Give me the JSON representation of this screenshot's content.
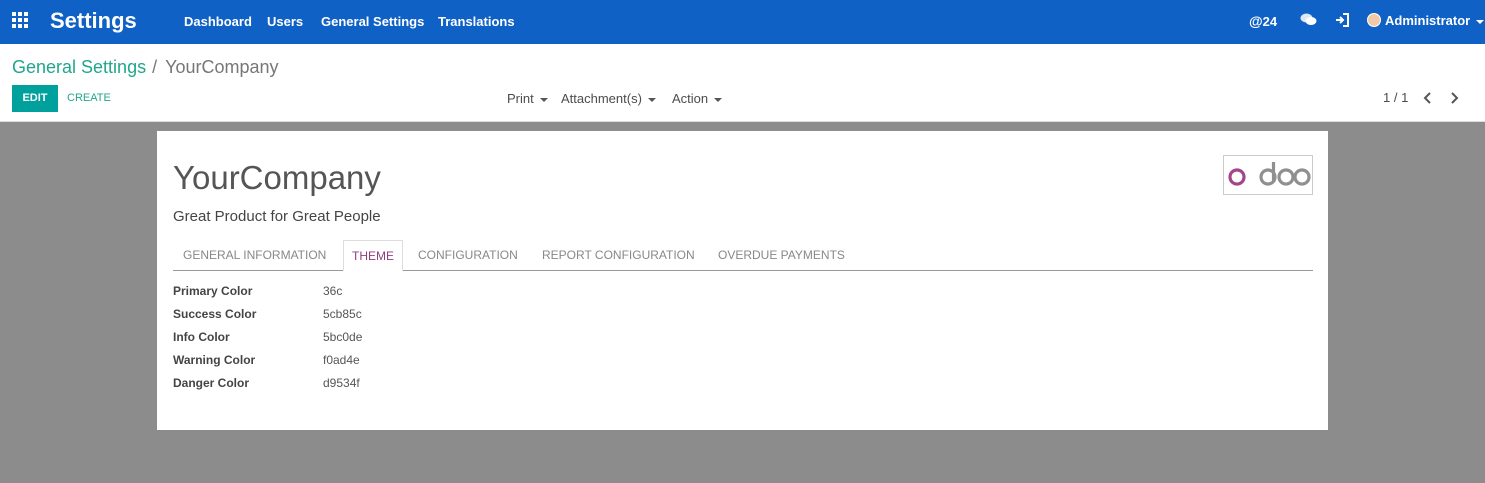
{
  "navbar": {
    "brand": "Settings",
    "menu": [
      "Dashboard",
      "Users",
      "General Settings",
      "Translations"
    ],
    "notifications_count": "24",
    "user_name": "Administrator",
    "color": "#1061c6"
  },
  "control_panel": {
    "breadcrumb_parent": "General Settings",
    "breadcrumb_separator": "/",
    "breadcrumb_current": "YourCompany",
    "edit_label": "EDIT",
    "create_label": "CREATE",
    "dropdowns": [
      "Print",
      "Attachment(s)",
      "Action"
    ],
    "pager": "1 / 1"
  },
  "form": {
    "company_name": "YourCompany",
    "tagline": "Great Product for Great People",
    "logo_text": "odoo",
    "tabs": [
      "GENERAL INFORMATION",
      "THEME",
      "CONFIGURATION",
      "REPORT CONFIGURATION",
      "OVERDUE PAYMENTS"
    ],
    "active_tab": "THEME",
    "fields": [
      {
        "label": "Primary Color",
        "value": "36c"
      },
      {
        "label": "Success Color",
        "value": "5cb85c"
      },
      {
        "label": "Info Color",
        "value": "5bc0de"
      },
      {
        "label": "Warning Color",
        "value": "f0ad4e"
      },
      {
        "label": "Danger Color",
        "value": "d9534f"
      }
    ]
  },
  "colors": {
    "accent": "#21a68c",
    "edit_button": "#00a09d",
    "active_tab": "#8f3f7d",
    "backdrop": "#8c8c8c"
  }
}
